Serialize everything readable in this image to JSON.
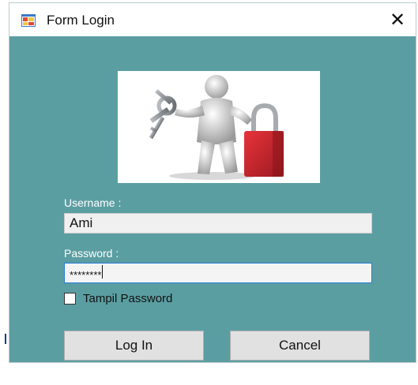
{
  "window": {
    "title": "Form Login",
    "close_glyph": "✕",
    "icon": "form-app-icon"
  },
  "form": {
    "username_label": "Username :",
    "username_value": "Ami",
    "password_label": "Password :",
    "password_value": "********",
    "show_password_label": "Tampil Password",
    "show_password_checked": false
  },
  "buttons": {
    "login_label": "Log In",
    "cancel_label": "Cancel"
  },
  "colors": {
    "client_background": "#5b9ea2",
    "lock_red": "#c8232c",
    "button_face": "#e1e1e1"
  },
  "illustration": "person-with-keys-and-padlock-image"
}
